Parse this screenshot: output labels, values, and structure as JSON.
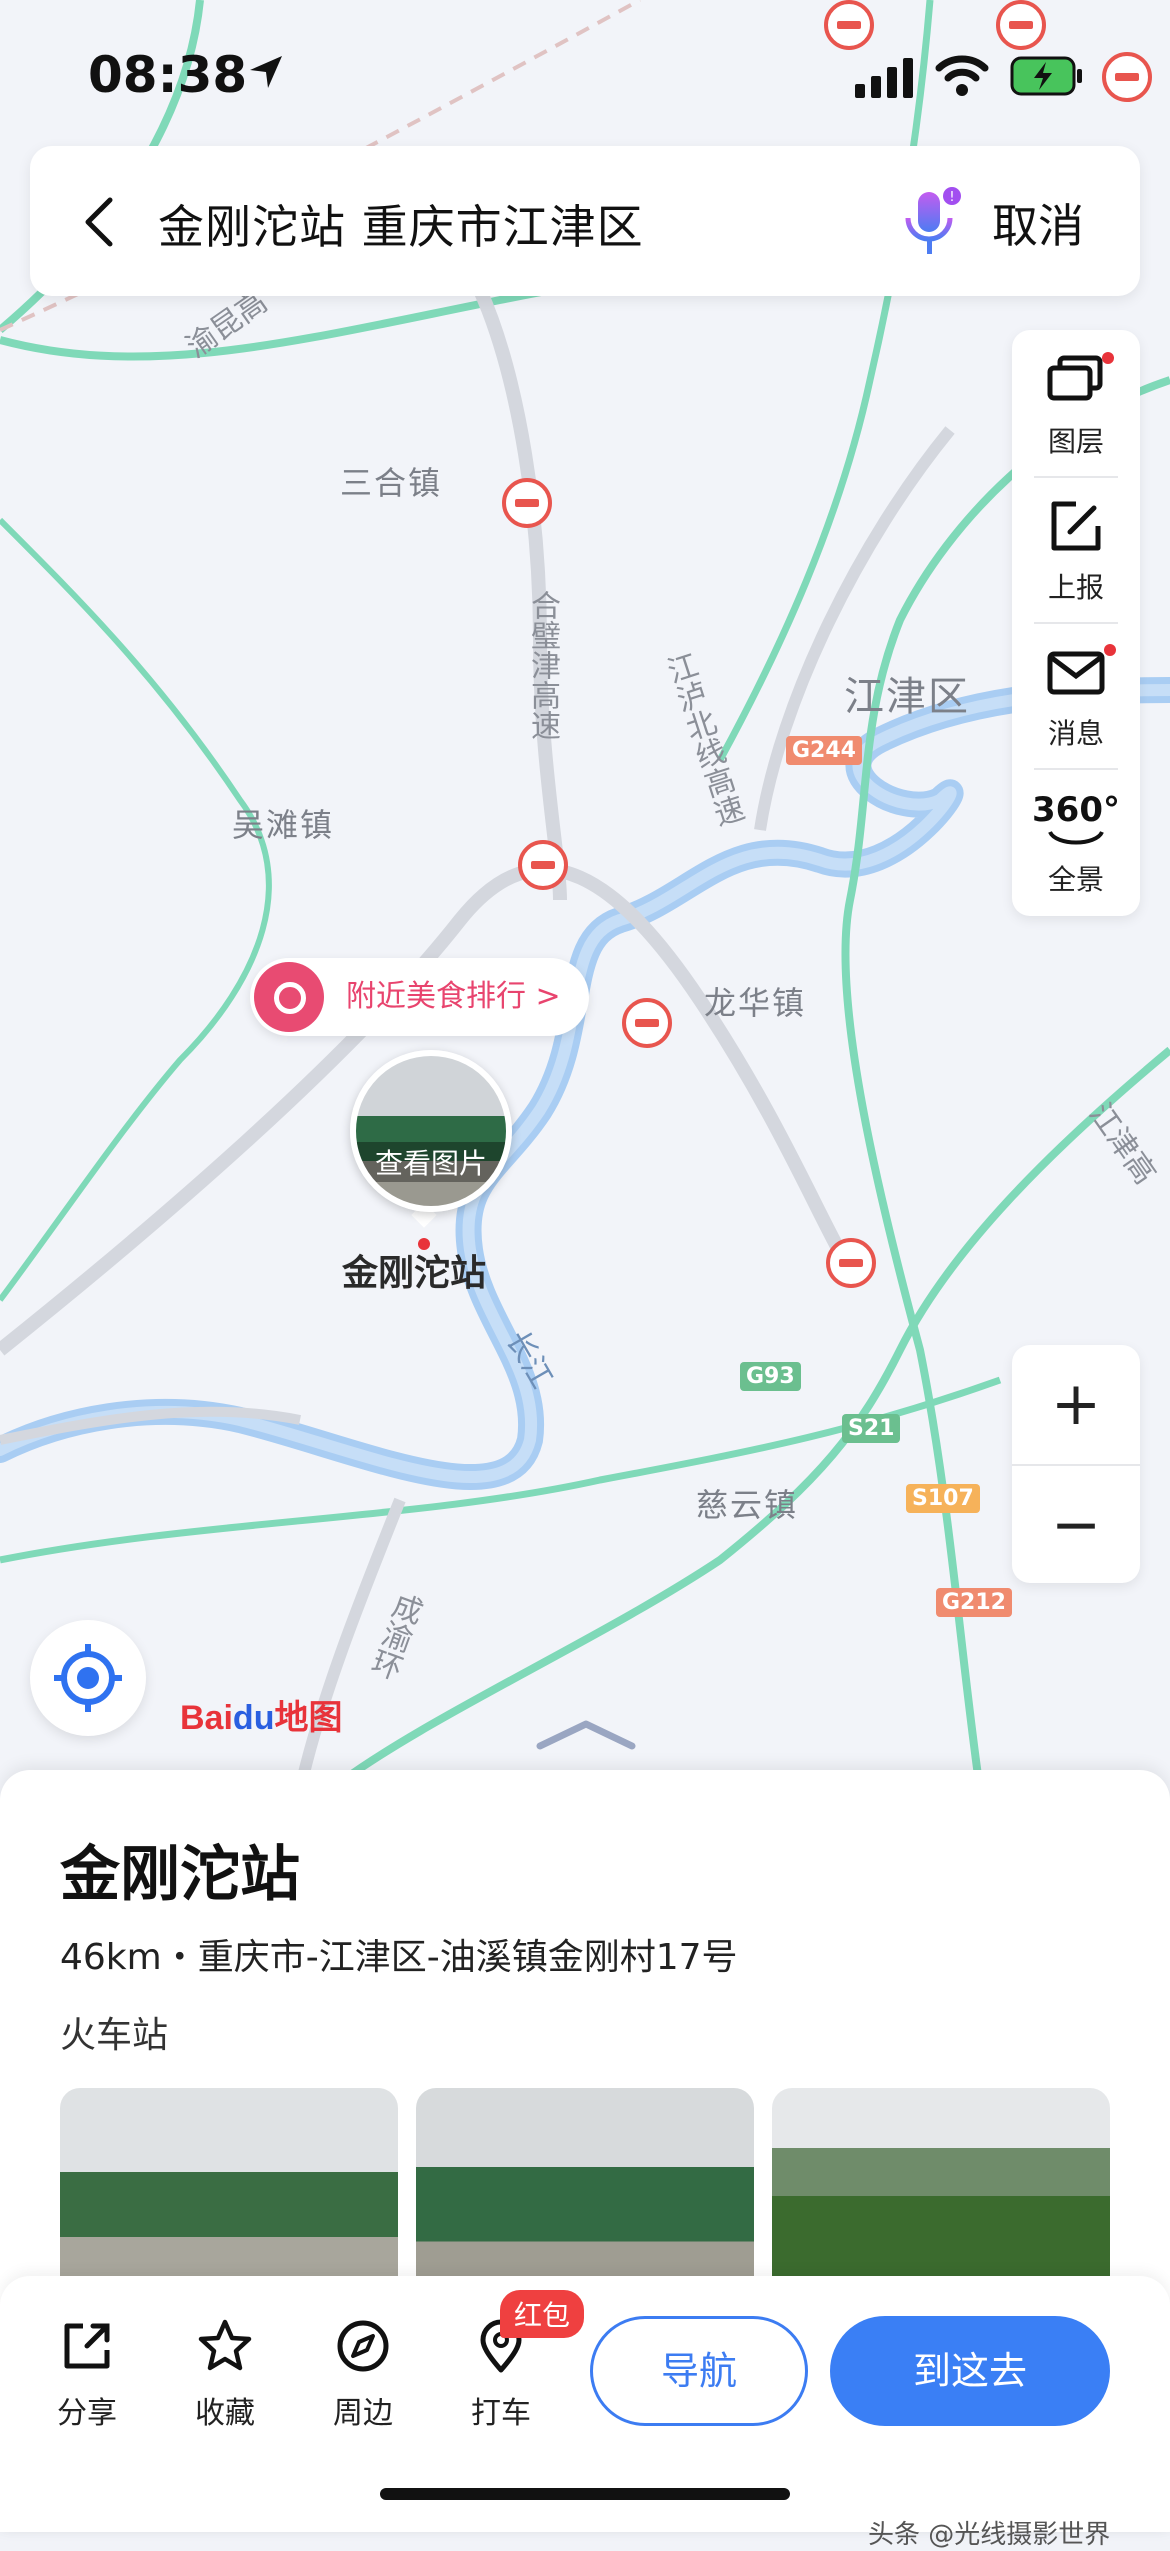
{
  "status_bar": {
    "time": "08:38"
  },
  "search_bar": {
    "query": "金刚沱站 重庆市江津区",
    "cancel_label": "取消"
  },
  "map_tools": {
    "layers": "图层",
    "report": "上报",
    "messages": "消息",
    "panorama": "全景",
    "panorama_badge": "360°",
    "zoom_in": "+",
    "zoom_out": "−"
  },
  "map_labels": {
    "towns": [
      "三合镇",
      "吴滩镇",
      "龙华镇",
      "慈云镇"
    ],
    "district": "江津区",
    "roads": [
      "渝昆高",
      "合璧津高速",
      "江泸北线高速",
      "长江",
      "成渝环",
      "江津高"
    ],
    "shields": [
      "G244",
      "G93",
      "S21",
      "S107",
      "G212"
    ]
  },
  "map_overlay": {
    "food_ranking": "附近美食排行 >",
    "view_photos": "查看图片",
    "poi_name": "金刚沱站",
    "logo_bai": "Bai",
    "logo_du": "du",
    "logo_map": "地图"
  },
  "place": {
    "title": "金刚沱站",
    "address": "46km・重庆市-江津区-油溪镇金刚村17号",
    "category": "火车站"
  },
  "bottom_actions": {
    "share": "分享",
    "favorite": "收藏",
    "nearby": "周边",
    "taxi": "打车",
    "hongbao": "红包",
    "navigate": "导航",
    "go_here": "到这去"
  },
  "watermark": "头条 @光线摄影世界",
  "colors": {
    "accent": "#3a7ff5",
    "alert_red": "#e8333a",
    "food_pink": "#e8446e",
    "river": "#a9cdf3",
    "highway": "#7fd9b8"
  }
}
